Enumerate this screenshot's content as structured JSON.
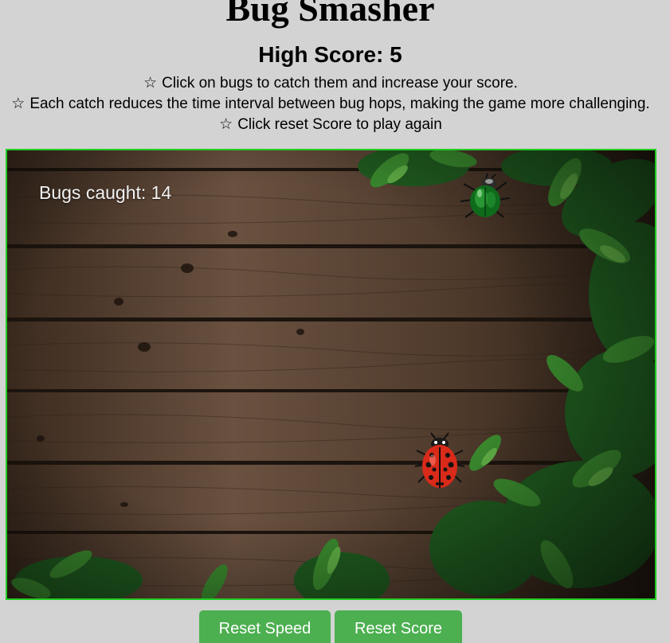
{
  "title": "Bug Smasher",
  "high_score": "High Score: 5",
  "instructions": [
    {
      "icon": "☆",
      "text": "Click on bugs to catch them and increase your score."
    },
    {
      "icon": "☆",
      "text": "Each catch reduces the time interval between bug hops, making the game more challenging."
    },
    {
      "icon": "☆",
      "text": "Click reset Score to play again"
    }
  ],
  "game": {
    "bugs_caught_label": "Bugs caught: 14",
    "border_color": "#22cc22",
    "bugs": [
      {
        "name": "green-beetle",
        "icon": "beetle-icon"
      },
      {
        "name": "red-ladybug",
        "icon": "ladybug-icon"
      }
    ]
  },
  "buttons": {
    "reset_speed": "Reset Speed",
    "reset_score": "Reset Score",
    "color": "#4caf50"
  }
}
